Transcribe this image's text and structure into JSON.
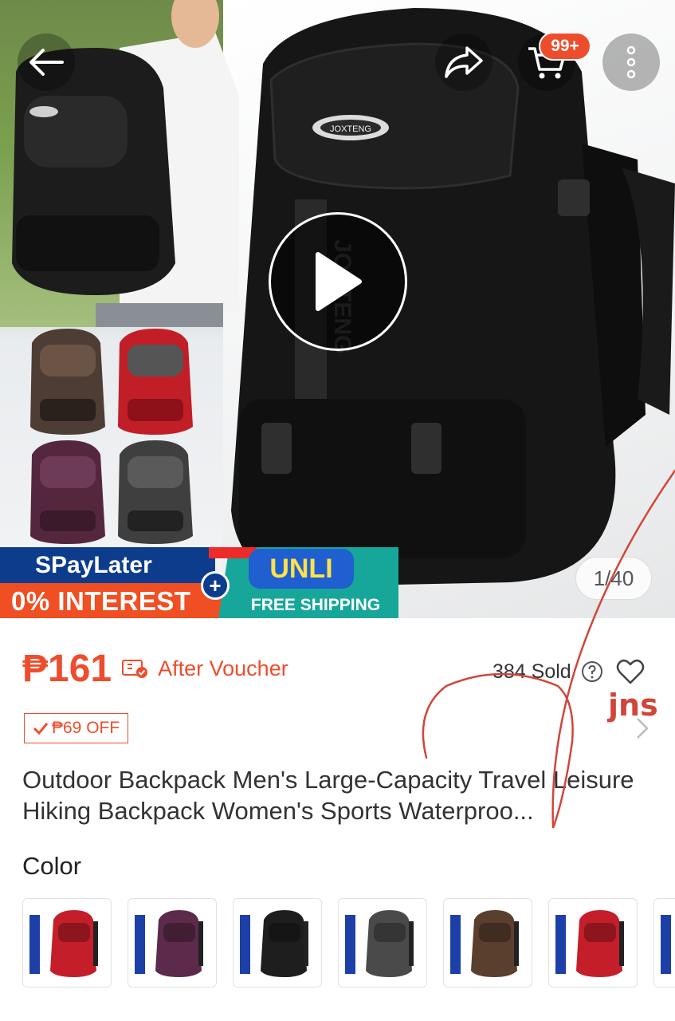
{
  "header": {
    "back_icon": "arrow-left-icon",
    "share_icon": "share-icon",
    "cart_icon": "cart-icon",
    "cart_badge": "99+",
    "more_icon": "more-vertical-icon"
  },
  "gallery": {
    "play_icon": "play-icon",
    "counter": "1/40",
    "backpack_logo_text": "JOXTENG",
    "promo": {
      "spaylater": "SPayLater",
      "interest": "0% INTEREST",
      "unli": "UNLI",
      "free_shipping": "FREE SHIPPING"
    }
  },
  "product": {
    "price": "₱161",
    "after_voucher": "After Voucher",
    "sold": "384 Sold",
    "discount_badge": "₱69 OFF",
    "title": "Outdoor Backpack Men's Large-Capacity Travel Leisure Hiking Backpack Women's Sports Waterproo...",
    "color_label": "Color"
  },
  "colors": {
    "accent": "#ee4d2d",
    "swatches": [
      "#c41e2a",
      "#5c2a4a",
      "#1e1e1e",
      "#4a4a4a",
      "#5a3e2e",
      "#c41e2a",
      "#1d3fa8"
    ]
  },
  "annotation": {
    "handwriting": "jns"
  }
}
